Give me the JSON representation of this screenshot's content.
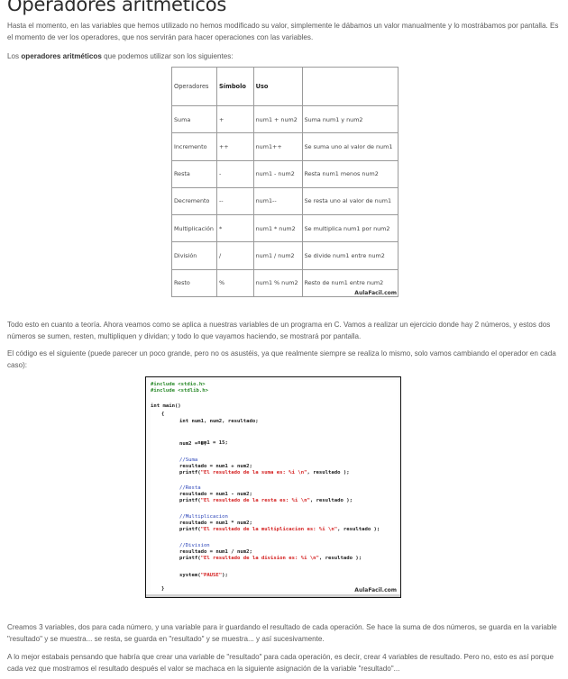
{
  "page": {
    "title": "Operadores aritméticos",
    "intro": "Hasta el momento, en las variables que hemos utilizado no hemos modificado su valor, simplemente le dábamos un valor manualmente y lo mostrábamos por pantalla. Es el momento de ver los operadores, que nos servirán para hacer operaciones con las variables.",
    "lead_prefix": "Los ",
    "lead_bold": "operadores aritméticos",
    "lead_suffix": " que podemos utilizar son los siguientes:",
    "after_table": "Todo esto en cuanto a teoría. Ahora veamos como se aplica a nuestras variables de un programa en C. Vamos a realizar un ejercicio donde hay 2 números, y estos dos números se sumen, resten, multipliquen y dividan; y todo lo que vayamos haciendo, se mostrará por pantalla.",
    "before_code": "El código es el siguiente (puede parecer un poco grande, pero no os asustéis, ya que realmente siempre se realiza lo mismo, solo vamos cambiando el operador en cada caso):",
    "after_code_1": "Creamos 3 variables, dos para cada número, y una variable para ir guardando el resultado de cada operación. Se hace la suma de dos números, se guarda en la variable \"resultado\" y se muestra... se resta, se guarda en \"resultado\" y se muestra... y así sucesivamente.",
    "after_code_2": "A lo mejor estabais pensando que habría que crear una variable de \"resultado\" para cada operación, es decir, crear 4 variables de resultado. Pero no, esto es así porque cada vez que mostramos el resultado después el valor se machaca en la siguiente asignación de la variable \"resultado\"..."
  },
  "ops_table": {
    "headers": [
      "Operadores",
      "Símbolo",
      "Uso",
      ""
    ],
    "rows": [
      [
        "Suma",
        "+",
        "num1 + num2",
        "Suma num1 y num2"
      ],
      [
        "Incremento",
        "++",
        "num1++",
        "Se suma uno al valor de num1"
      ],
      [
        "Resta",
        "-",
        "num1 - num2",
        "Resta num1 menos num2"
      ],
      [
        "Decremento",
        "--",
        "num1--",
        "Se resta uno al valor de num1"
      ],
      [
        "Multiplicación",
        "*",
        "num1 * num2",
        "Se multiplica num1 por num2"
      ],
      [
        "División",
        "/",
        "num1 / num2",
        "Se divide num1 entre num2"
      ],
      [
        "Resto",
        "%",
        "num1 % num2",
        "Resto de num1 entre num2"
      ]
    ],
    "watermark": "AulaFacil.com"
  },
  "code": {
    "inc1": "#include <stdio.h>",
    "inc2": "#include <stdlib.h>",
    "main": "int main()",
    "open": "{",
    "decl": "int num1, num2, resultado;",
    "a1": "num1 = 15;",
    "a2": "num2 = 8;",
    "c_sum": "//Suma",
    "sum_op": "resultado = num1 + num2;",
    "sum_pf": "printf(",
    "sum_str": "\"El resultado de la suma es: %i \\n\"",
    "sum_end": ", resultado );",
    "c_res": "//Resta",
    "res_op": "resultado = num1 - num2;",
    "res_pf": "printf(",
    "res_str": "\"El resultado de la resta es: %i \\n\"",
    "res_end": ", resultado );",
    "c_mul": "//Multiplicacion",
    "mul_op": "resultado = num1 * num2;",
    "mul_pf": "printf(",
    "mul_str": "\"El resultado de la multiplicacion es: %i \\n\"",
    "mul_end": ", resultado );",
    "c_div": "//Division",
    "div_op": "resultado = num1 / num2;",
    "div_pf": "printf(",
    "div_str": "\"El resultado de la division es: %i \\n\"",
    "div_end": ", resultado );",
    "sys_pre": "system(",
    "sys_str": "\"PAUSE\"",
    "sys_end": ");",
    "close": "}",
    "watermark": "AulaFacil.com"
  }
}
